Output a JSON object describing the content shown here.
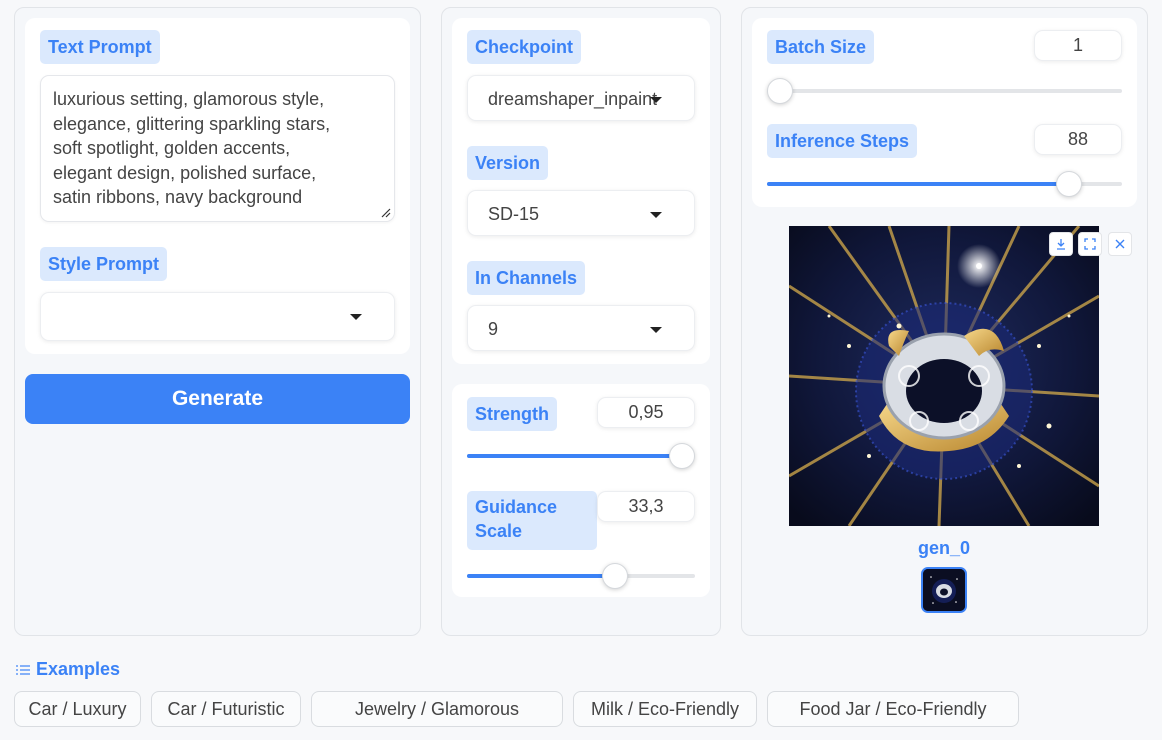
{
  "left": {
    "text_prompt_label": "Text Prompt",
    "text_prompt_lines": [
      "luxurious setting, glamorous style,",
      "elegance, glittering sparkling stars,",
      "soft spotlight, golden accents,",
      "elegant design, polished surface,",
      "satin ribbons, navy background"
    ],
    "style_prompt_label": "Style Prompt",
    "style_prompt_value": "",
    "generate_label": "Generate"
  },
  "middle": {
    "checkpoint_label": "Checkpoint",
    "checkpoint_value": "dreamshaper_inpaint",
    "version_label": "Version",
    "version_value": "SD-15",
    "in_channels_label": "In Channels",
    "in_channels_value": "9",
    "strength_label": "Strength",
    "strength_value": "0,95",
    "strength_fraction": 0.95,
    "guidance_label_line1": "Guidance",
    "guidance_label_line2": "Scale",
    "guidance_value": "33,3",
    "guidance_fraction": 0.65
  },
  "right": {
    "batch_size_label": "Batch Size",
    "batch_size_value": "1",
    "batch_fraction": 0.0,
    "inference_steps_label": "Inference Steps",
    "inference_steps_value": "88",
    "inference_fraction": 0.85,
    "gallery_caption": "gen_0"
  },
  "examples": {
    "title": "Examples",
    "items": [
      "Car / Luxury",
      "Car / Futuristic",
      "Jewelry / Glamorous",
      "Milk / Eco-Friendly",
      "Food Jar / Eco-Friendly"
    ]
  },
  "colors": {
    "accent": "#3b82f6",
    "label_bg": "#dbe9fd",
    "image_bg": "#0f1430"
  }
}
